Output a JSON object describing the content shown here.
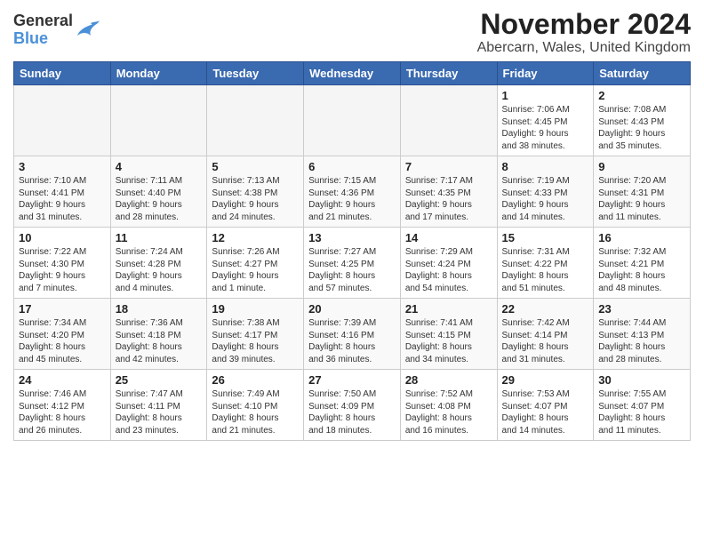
{
  "logo": {
    "line1": "General",
    "line2": "Blue"
  },
  "title": {
    "main": "November 2024",
    "sub": "Abercarn, Wales, United Kingdom"
  },
  "calendar": {
    "headers": [
      "Sunday",
      "Monday",
      "Tuesday",
      "Wednesday",
      "Thursday",
      "Friday",
      "Saturday"
    ],
    "weeks": [
      [
        {
          "day": "",
          "info": ""
        },
        {
          "day": "",
          "info": ""
        },
        {
          "day": "",
          "info": ""
        },
        {
          "day": "",
          "info": ""
        },
        {
          "day": "",
          "info": ""
        },
        {
          "day": "1",
          "info": "Sunrise: 7:06 AM\nSunset: 4:45 PM\nDaylight: 9 hours\nand 38 minutes."
        },
        {
          "day": "2",
          "info": "Sunrise: 7:08 AM\nSunset: 4:43 PM\nDaylight: 9 hours\nand 35 minutes."
        }
      ],
      [
        {
          "day": "3",
          "info": "Sunrise: 7:10 AM\nSunset: 4:41 PM\nDaylight: 9 hours\nand 31 minutes."
        },
        {
          "day": "4",
          "info": "Sunrise: 7:11 AM\nSunset: 4:40 PM\nDaylight: 9 hours\nand 28 minutes."
        },
        {
          "day": "5",
          "info": "Sunrise: 7:13 AM\nSunset: 4:38 PM\nDaylight: 9 hours\nand 24 minutes."
        },
        {
          "day": "6",
          "info": "Sunrise: 7:15 AM\nSunset: 4:36 PM\nDaylight: 9 hours\nand 21 minutes."
        },
        {
          "day": "7",
          "info": "Sunrise: 7:17 AM\nSunset: 4:35 PM\nDaylight: 9 hours\nand 17 minutes."
        },
        {
          "day": "8",
          "info": "Sunrise: 7:19 AM\nSunset: 4:33 PM\nDaylight: 9 hours\nand 14 minutes."
        },
        {
          "day": "9",
          "info": "Sunrise: 7:20 AM\nSunset: 4:31 PM\nDaylight: 9 hours\nand 11 minutes."
        }
      ],
      [
        {
          "day": "10",
          "info": "Sunrise: 7:22 AM\nSunset: 4:30 PM\nDaylight: 9 hours\nand 7 minutes."
        },
        {
          "day": "11",
          "info": "Sunrise: 7:24 AM\nSunset: 4:28 PM\nDaylight: 9 hours\nand 4 minutes."
        },
        {
          "day": "12",
          "info": "Sunrise: 7:26 AM\nSunset: 4:27 PM\nDaylight: 9 hours\nand 1 minute."
        },
        {
          "day": "13",
          "info": "Sunrise: 7:27 AM\nSunset: 4:25 PM\nDaylight: 8 hours\nand 57 minutes."
        },
        {
          "day": "14",
          "info": "Sunrise: 7:29 AM\nSunset: 4:24 PM\nDaylight: 8 hours\nand 54 minutes."
        },
        {
          "day": "15",
          "info": "Sunrise: 7:31 AM\nSunset: 4:22 PM\nDaylight: 8 hours\nand 51 minutes."
        },
        {
          "day": "16",
          "info": "Sunrise: 7:32 AM\nSunset: 4:21 PM\nDaylight: 8 hours\nand 48 minutes."
        }
      ],
      [
        {
          "day": "17",
          "info": "Sunrise: 7:34 AM\nSunset: 4:20 PM\nDaylight: 8 hours\nand 45 minutes."
        },
        {
          "day": "18",
          "info": "Sunrise: 7:36 AM\nSunset: 4:18 PM\nDaylight: 8 hours\nand 42 minutes."
        },
        {
          "day": "19",
          "info": "Sunrise: 7:38 AM\nSunset: 4:17 PM\nDaylight: 8 hours\nand 39 minutes."
        },
        {
          "day": "20",
          "info": "Sunrise: 7:39 AM\nSunset: 4:16 PM\nDaylight: 8 hours\nand 36 minutes."
        },
        {
          "day": "21",
          "info": "Sunrise: 7:41 AM\nSunset: 4:15 PM\nDaylight: 8 hours\nand 34 minutes."
        },
        {
          "day": "22",
          "info": "Sunrise: 7:42 AM\nSunset: 4:14 PM\nDaylight: 8 hours\nand 31 minutes."
        },
        {
          "day": "23",
          "info": "Sunrise: 7:44 AM\nSunset: 4:13 PM\nDaylight: 8 hours\nand 28 minutes."
        }
      ],
      [
        {
          "day": "24",
          "info": "Sunrise: 7:46 AM\nSunset: 4:12 PM\nDaylight: 8 hours\nand 26 minutes."
        },
        {
          "day": "25",
          "info": "Sunrise: 7:47 AM\nSunset: 4:11 PM\nDaylight: 8 hours\nand 23 minutes."
        },
        {
          "day": "26",
          "info": "Sunrise: 7:49 AM\nSunset: 4:10 PM\nDaylight: 8 hours\nand 21 minutes."
        },
        {
          "day": "27",
          "info": "Sunrise: 7:50 AM\nSunset: 4:09 PM\nDaylight: 8 hours\nand 18 minutes."
        },
        {
          "day": "28",
          "info": "Sunrise: 7:52 AM\nSunset: 4:08 PM\nDaylight: 8 hours\nand 16 minutes."
        },
        {
          "day": "29",
          "info": "Sunrise: 7:53 AM\nSunset: 4:07 PM\nDaylight: 8 hours\nand 14 minutes."
        },
        {
          "day": "30",
          "info": "Sunrise: 7:55 AM\nSunset: 4:07 PM\nDaylight: 8 hours\nand 11 minutes."
        }
      ]
    ]
  }
}
